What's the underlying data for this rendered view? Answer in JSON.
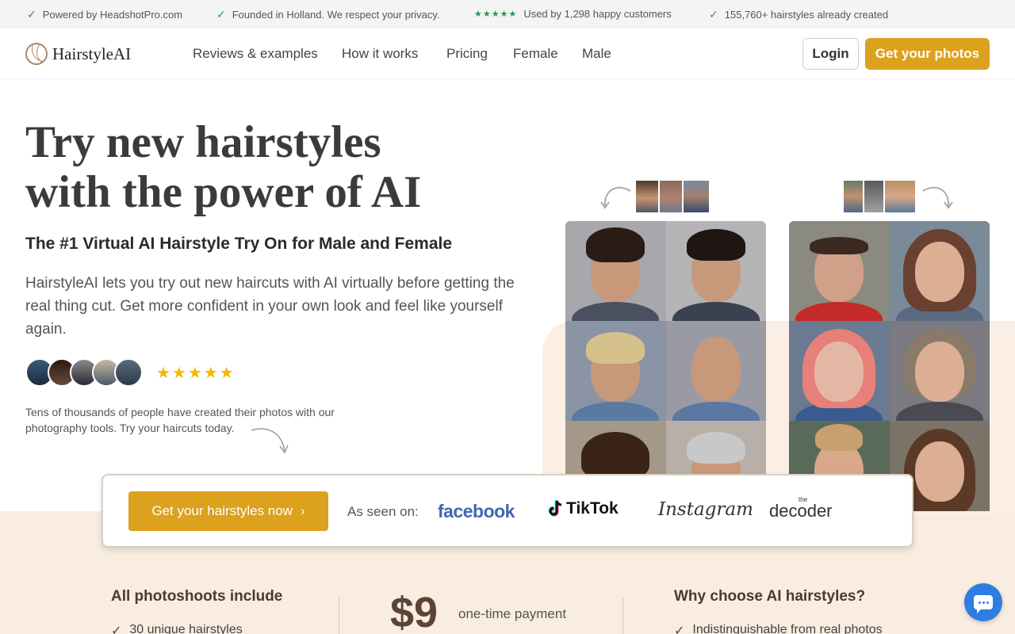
{
  "topbar": {
    "items": [
      "Powered by HeadshotPro.com",
      "Founded in Holland. We respect your privacy.",
      "Used by 1,298 happy customers",
      "155,760+ hairstyles already created"
    ]
  },
  "nav": {
    "logo": "HairstyleAI",
    "links": [
      "Reviews & examples",
      "How it works",
      "Pricing",
      "Female",
      "Male"
    ],
    "login": "Login",
    "cta": "Get your photos"
  },
  "hero": {
    "title_line1": "Try new hairstyles",
    "title_line2": "with the power of AI",
    "subtitle": "The #1 Virtual AI Hairstyle Try On for Male and Female",
    "description": "HairstyleAI lets you try out new haircuts with AI virtually before getting the real thing cut. Get more confident in your own look and feel like yourself again.",
    "rating_stars": "★★★★★",
    "social_proof": "Tens of thousands of people have created their photos with our photography tools. Try your haircuts today."
  },
  "cta_strip": {
    "button": "Get your hairstyles now",
    "seen_on": "As seen on:",
    "brands": [
      "facebook",
      "TikTok",
      "Instagram",
      "decoder"
    ],
    "decoder_prefix": "the"
  },
  "features": {
    "left_title": "All photoshoots include",
    "left_item": "30 unique hairstyles",
    "price": "$9",
    "price_note": "one-time payment",
    "right_title": "Why choose AI hairstyles?",
    "right_item": "Indistinguishable from real photos"
  },
  "colors": {
    "accent": "#dca11d",
    "beige": "#f9ece1",
    "check": "#22a04a",
    "chat": "#2f7de1"
  }
}
